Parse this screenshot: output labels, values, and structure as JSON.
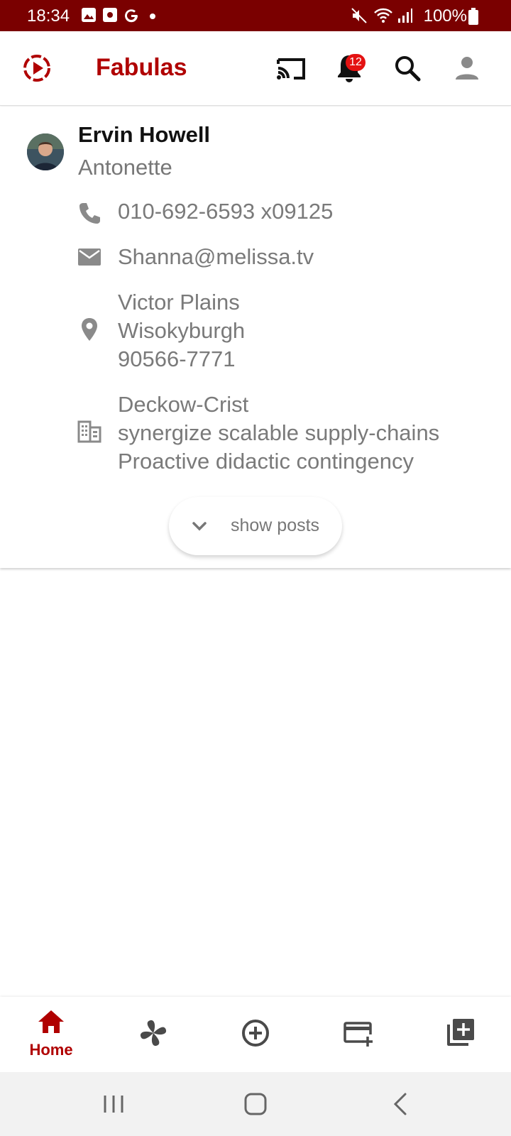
{
  "status_bar": {
    "time": "18:34",
    "battery": "100%"
  },
  "app_bar": {
    "title": "Fabulas",
    "notification_count": "12",
    "accent_color": "#b00000"
  },
  "profile": {
    "name": "Ervin Howell",
    "username": "Antonette",
    "phone": "010-692-6593 x09125",
    "email": "Shanna@melissa.tv",
    "address": {
      "street": "Victor Plains",
      "city": "Wisokyburgh",
      "zipcode": "90566-7771"
    },
    "company": {
      "name": "Deckow-Crist",
      "bs": "synergize scalable supply-chains",
      "catch_phrase": "Proactive didactic contingency"
    },
    "show_posts_label": "show posts"
  },
  "bottom_nav": {
    "items": [
      {
        "icon": "home-icon",
        "label": "Home",
        "active": true
      },
      {
        "icon": "pinwheel-icon",
        "label": "",
        "active": false
      },
      {
        "icon": "add-circle-icon",
        "label": "",
        "active": false
      },
      {
        "icon": "card-add-icon",
        "label": "",
        "active": false
      },
      {
        "icon": "library-add-icon",
        "label": "",
        "active": false
      }
    ]
  }
}
